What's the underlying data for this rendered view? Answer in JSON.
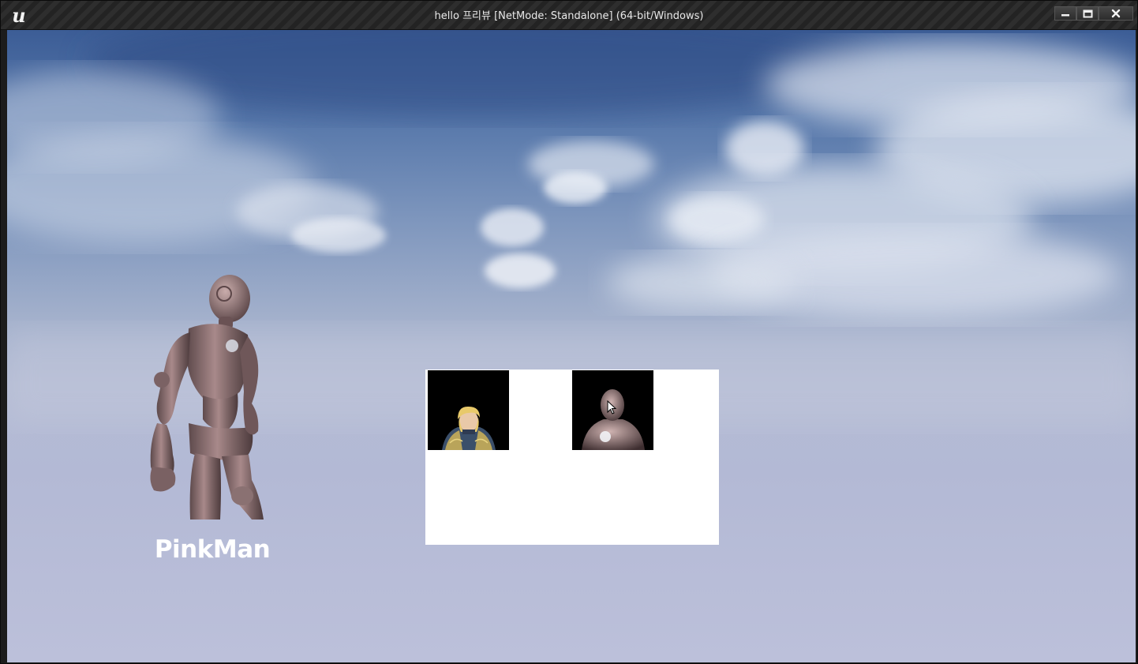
{
  "window": {
    "title": "hello 프리뷰 [NetMode: Standalone] (64-bit/Windows)",
    "logo_icon": "unreal-engine-logo-icon",
    "logo_glyph": "u",
    "controls": [
      "minimize",
      "maximize",
      "close"
    ]
  },
  "scene": {
    "background": "sky-with-clouds",
    "character_model": "mannequin-figure",
    "character_name": "PinkMan"
  },
  "select_panel": {
    "slots": [
      {
        "portrait": "blonde-armored-hero-portrait"
      },
      {
        "portrait": "mannequin-portrait"
      }
    ],
    "background": "#ffffff"
  },
  "colors": {
    "sky_top": "#3c5d96",
    "sky_horizon": "#b4bcd4",
    "title_text": "#e8e8e8",
    "label_text": "#ffffff"
  }
}
